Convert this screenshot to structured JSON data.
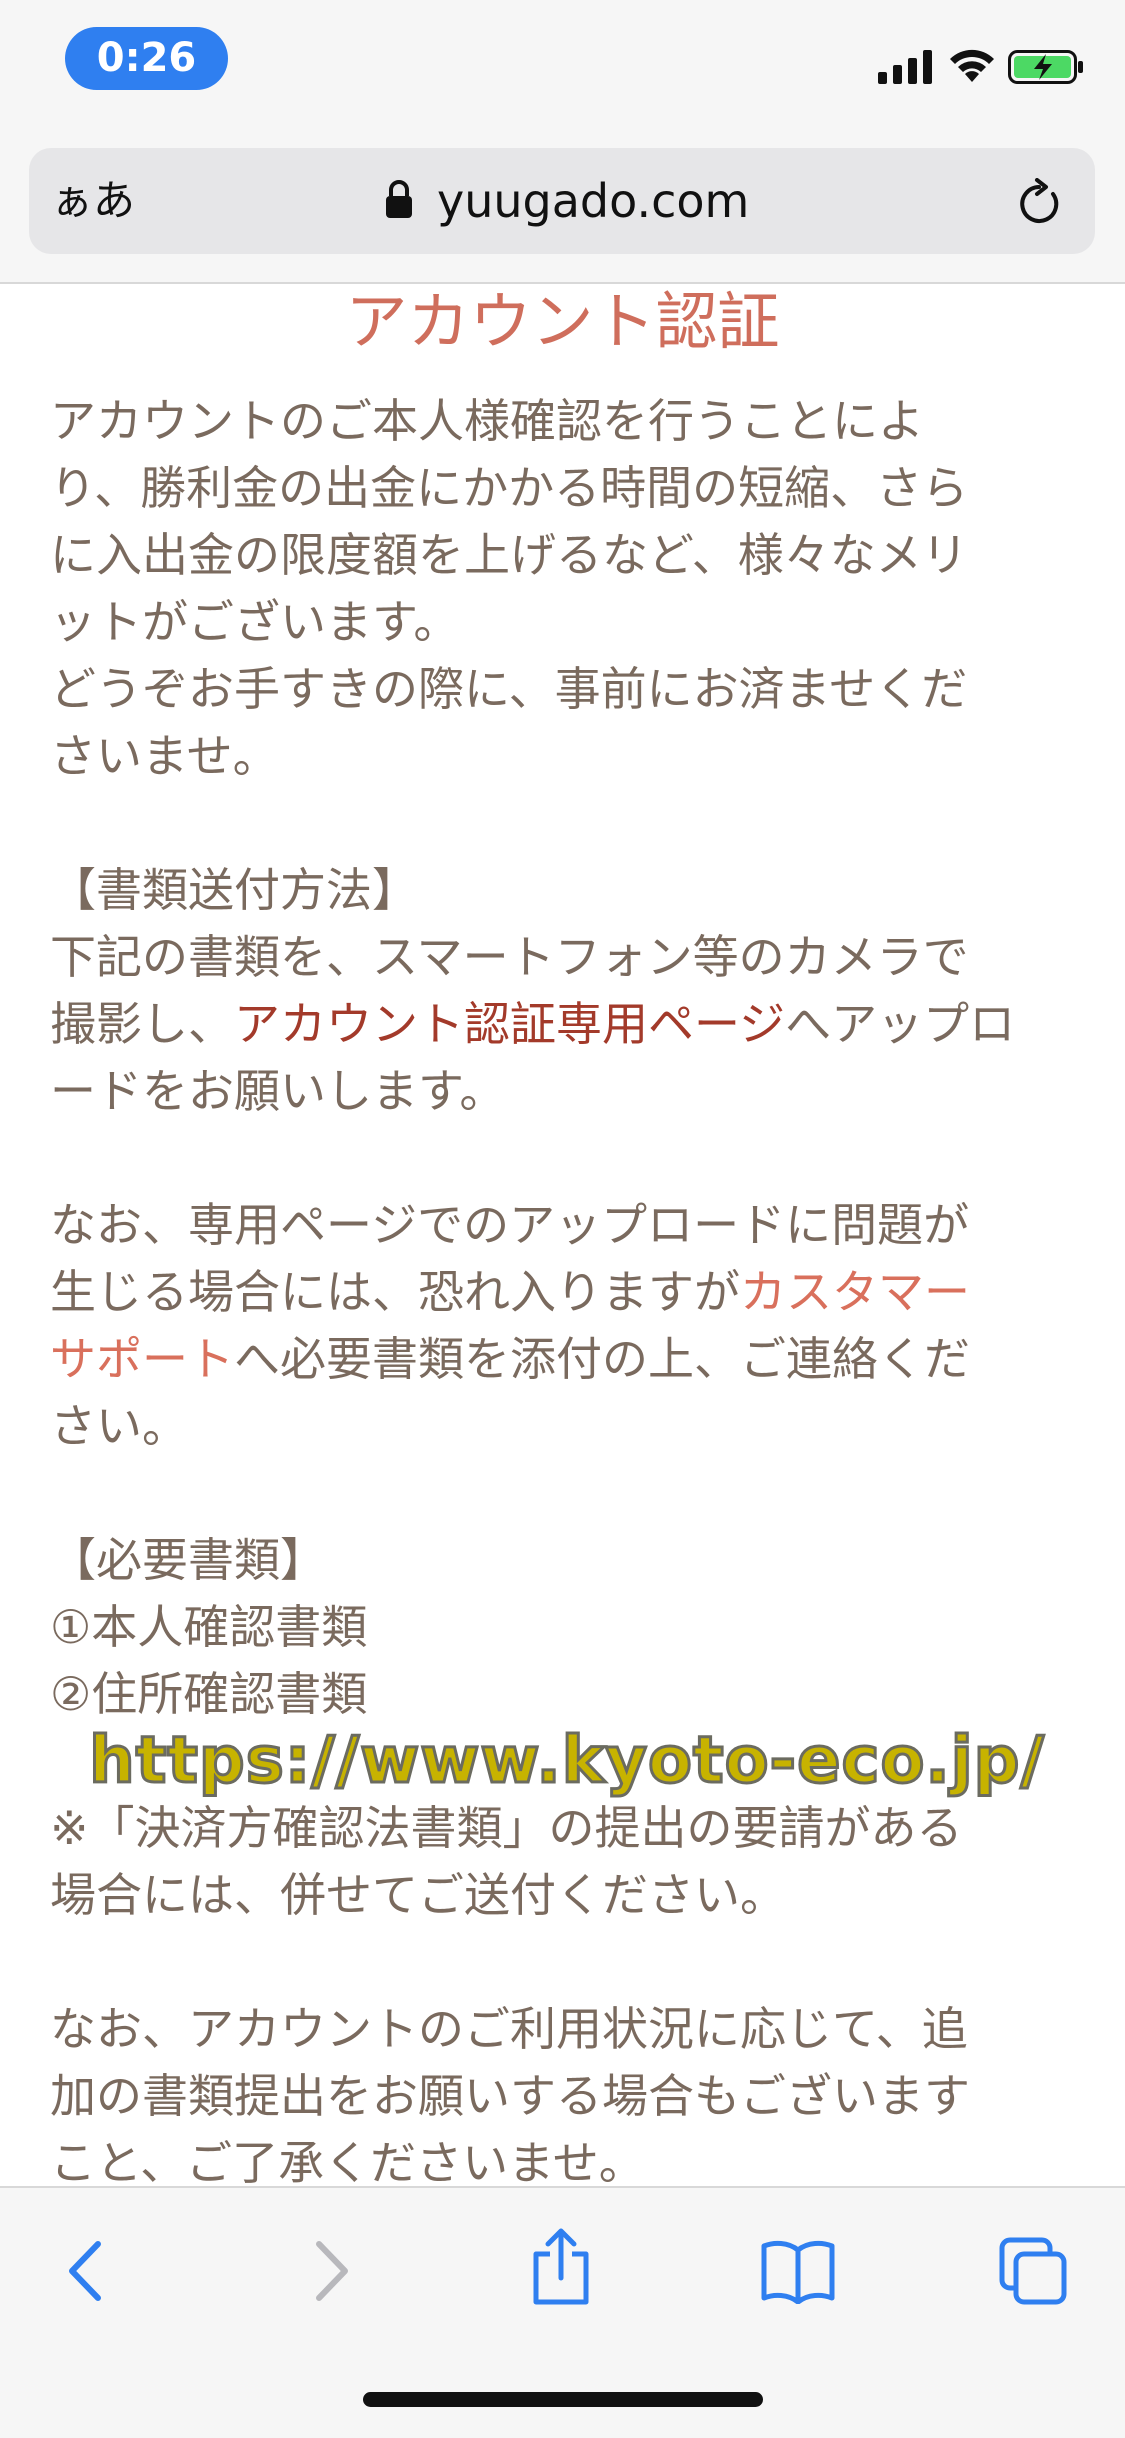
{
  "status": {
    "time": "0:26"
  },
  "browser": {
    "aa_label": "ぁあ",
    "url": "yuugado.com"
  },
  "page": {
    "title": "アカウント認証",
    "para1_line1": "アカウントのご本人様確認を行うことによ",
    "para1_line2": "り、勝利金の出金にかかる時間の短縮、さら",
    "para1_line3": "に入出金の限度額を上げるなど、様々なメリ",
    "para1_line4": "ットがございます。",
    "para1_line5": "どうぞお手すきの際に、事前にお済ませくだ",
    "para1_line6": "さいませ。",
    "method_heading": "【書類送付方法】",
    "method_line1": "下記の書類を、スマートフォン等のカメラで",
    "method_line2_pre": "撮影し、",
    "method_link": "アカウント認証専用ページ",
    "method_line2_post": "へアップロ",
    "method_line3": "ードをお願いします。",
    "note_line1": "なお、専用ページでのアップロードに問題が",
    "note_line2_pre": "生じる場合には、恐れ入りますが",
    "support_link_a": "カスタマー",
    "support_link_b": "サポート",
    "note_line3_post": "へ必要書類を添付の上、ご連絡くだ",
    "note_line4": "さい。",
    "required_heading": "【必要書類】",
    "required_item1": "①本人確認書類",
    "required_item2": "②住所確認書類",
    "remark_line1": "※「決済方確認法書類」の提出の要請がある",
    "remark_line2": "場合には、併せてご送付ください。",
    "final_line1": "なお、アカウントのご利用状況に応じて、追",
    "final_line2": "加の書類提出をお願いする場合もございます",
    "final_line3": "こと、ご了承くださいませ。"
  },
  "watermark": "https://www.kyoto-eco.jp/",
  "colors": {
    "title": "#cf6e5c",
    "link_dark": "#a33a2a",
    "link_red": "#d9705c",
    "accent": "#2f7ff0"
  }
}
